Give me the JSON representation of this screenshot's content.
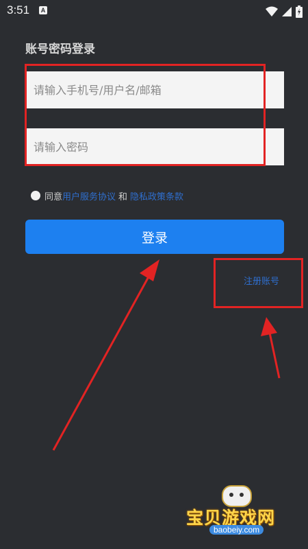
{
  "status_bar": {
    "time": "3:51",
    "app_icon_letter": "A",
    "icons": [
      "wifi-icon",
      "signal-icon",
      "battery-icon"
    ]
  },
  "page": {
    "title": "账号密码登录"
  },
  "form": {
    "account_placeholder": "请输入手机号/用户名/邮箱",
    "password_placeholder": "请输入密码"
  },
  "agreement": {
    "prefix": "同意",
    "user_agreement": "用户服务协议",
    "conjunction": "和",
    "privacy_policy": "隐私政策条款"
  },
  "actions": {
    "login_label": "登录",
    "register_label": "注册账号"
  },
  "watermark": {
    "name": "宝贝游戏网",
    "domain": "baobeiy.com"
  },
  "colors": {
    "background": "#2b2d31",
    "primary_button": "#1d80f0",
    "link": "#2f6fcf",
    "annotation": "#e22323"
  }
}
